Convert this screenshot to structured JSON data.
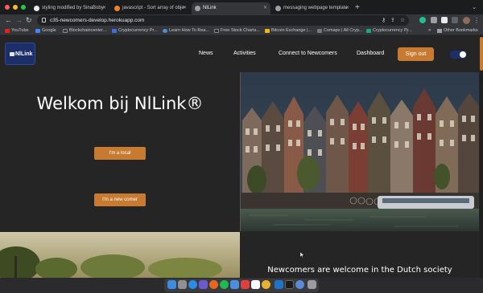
{
  "browser": {
    "tabs": [
      {
        "title": "styling modified by SinaBoby",
        "active": false
      },
      {
        "title": "javascript - Sort array of obje",
        "active": false
      },
      {
        "title": "NlLink",
        "active": true
      },
      {
        "title": "messaging webpage template",
        "active": false
      }
    ],
    "new_tab_glyph": "+",
    "url": "c35-newcomers-develop.herokuapp.com",
    "bookmarks": [
      {
        "label": "YouTube",
        "color": "#e62117"
      },
      {
        "label": "Google",
        "color": "#4285f4"
      },
      {
        "label": "Blockchaincenter...",
        "color": "#3b3b3b"
      },
      {
        "label": "Cryptocurrency Pr...",
        "color": "#3c6ee0"
      },
      {
        "label": "Learn How To Rea...",
        "color": "#4a90d9"
      },
      {
        "label": "Free Stock Charts...",
        "color": "#2a2a2a"
      },
      {
        "label": "Bitcoin Exchange |...",
        "color": "#f0b90b"
      },
      {
        "label": "Comaps | All Cryp...",
        "color": "#777777"
      },
      {
        "label": "Cryptocurrency Pr...",
        "color": "#1fa77a"
      }
    ],
    "bookmarks_more": "»",
    "other_bookmarks": "Other Bookmarks"
  },
  "site": {
    "logo_text": "NlLink",
    "nav": [
      "News",
      "Activities",
      "Connect to Newcomers",
      "Dashboard"
    ],
    "sign_out": "Sign out",
    "hero_title": "Welkom bij NlLink®",
    "cta_local": "I'm a local",
    "cta_newcomer": "I'm a new comer",
    "welcome_text": "Newcomers are welcome in the Dutch society"
  },
  "colors": {
    "accent": "#c77a30",
    "brand": "#1d2f6b",
    "page_bg": "#252525"
  },
  "icons": [
    "back-icon",
    "forward-icon",
    "reload-icon",
    "lock-icon",
    "key-icon",
    "share-icon",
    "star-icon",
    "extension-icon",
    "profile-avatar",
    "menu-kebab-icon"
  ]
}
